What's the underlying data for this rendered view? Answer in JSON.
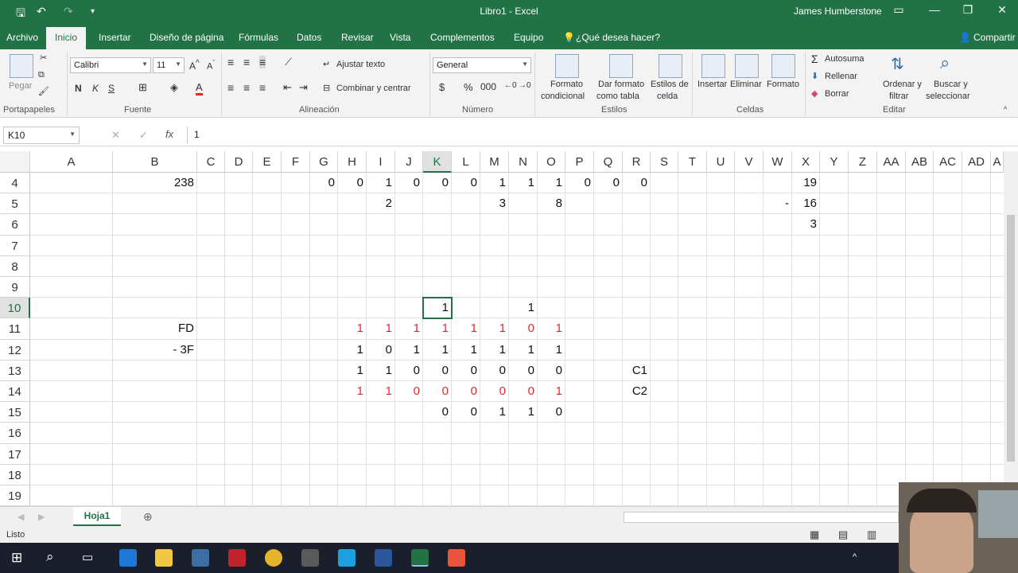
{
  "titlebar": {
    "title": "Libro1  -  Excel",
    "user": "James Humberstone"
  },
  "menu": {
    "archivo": "Archivo",
    "inicio": "Inicio",
    "insertar": "Insertar",
    "diseno": "Diseño de página",
    "formulas": "Fórmulas",
    "datos": "Datos",
    "revisar": "Revisar",
    "vista": "Vista",
    "complementos": "Complementos",
    "equipo": "Equipo",
    "tell": "¿Qué desea hacer?",
    "share": "Compartir"
  },
  "ribbon": {
    "pegar": "Pegar",
    "portapapeles": "Portapapeles",
    "font_name": "Calibri",
    "font_size": "11",
    "fuente": "Fuente",
    "ajustar": "Ajustar texto",
    "combinar": "Combinar y centrar",
    "alineacion": "Alineación",
    "numfmt": "General",
    "numero": "Número",
    "formato_cond_1": "Formato",
    "formato_cond_2": "condicional",
    "dar_formato_1": "Dar formato",
    "dar_formato_2": "como tabla",
    "estilos_celda_1": "Estilos de",
    "estilos_celda_2": "celda",
    "estilos": "Estilos",
    "insertar": "Insertar",
    "eliminar": "Eliminar",
    "formato": "Formato",
    "celdas": "Celdas",
    "autosuma": "Autosuma",
    "rellenar": "Rellenar",
    "borrar": "Borrar",
    "ordenar_1": "Ordenar y",
    "ordenar_2": "filtrar",
    "buscar_1": "Buscar y",
    "buscar_2": "seleccionar",
    "editar": "Editar"
  },
  "formula_bar": {
    "name_box": "K10",
    "formula": "1",
    "fx": "fx"
  },
  "columns": [
    "A",
    "B",
    "C",
    "D",
    "E",
    "F",
    "G",
    "H",
    "I",
    "J",
    "K",
    "L",
    "M",
    "N",
    "O",
    "P",
    "Q",
    "R",
    "S",
    "T",
    "U",
    "V",
    "W",
    "X",
    "Y",
    "Z",
    "AA",
    "AB",
    "AC",
    "AD",
    "A"
  ],
  "rows": [
    "4",
    "5",
    "6",
    "7",
    "8",
    "9",
    "10",
    "11",
    "12",
    "13",
    "14",
    "15",
    "16",
    "17",
    "18",
    "19"
  ],
  "cells": {
    "b4": "238",
    "g4": "0",
    "h4": "0",
    "i4": "1",
    "j4": "0",
    "k4": "0",
    "l4": "0",
    "m4": "1",
    "n4": "1",
    "o4": "1",
    "p4": "0",
    "q4": "0",
    "r4": "0",
    "x4": "19",
    "i5": "2",
    "m5": "3",
    "o5": "8",
    "w5": "-",
    "x5": "16",
    "x6": "3",
    "k10": "1",
    "n10": "1",
    "b11": "FD",
    "h11": "1",
    "i11": "1",
    "j11": "1",
    "k11": "1",
    "l11": "1",
    "m11": "1",
    "n11": "0",
    "o11": "1",
    "b12": "-  3F",
    "h12": "1",
    "i12": "0",
    "j12": "1",
    "k12": "1",
    "l12": "1",
    "m12": "1",
    "n12": "1",
    "o12": "1",
    "h13": "1",
    "i13": "1",
    "j13": "0",
    "k13": "0",
    "l13": "0",
    "m13": "0",
    "n13": "0",
    "o13": "0",
    "r13": "C1",
    "h14": "1",
    "i14": "1",
    "j14": "0",
    "k14": "0",
    "l14": "0",
    "m14": "0",
    "n14": "0",
    "o14": "1",
    "r14": "C2",
    "k15": "0",
    "l15": "0",
    "m15": "1",
    "n15": "1",
    "o15": "0"
  },
  "sheet": {
    "tab": "Hoja1",
    "status": "Listo"
  },
  "colors": {
    "accent": "#217346",
    "red_text": "#e0282f"
  }
}
